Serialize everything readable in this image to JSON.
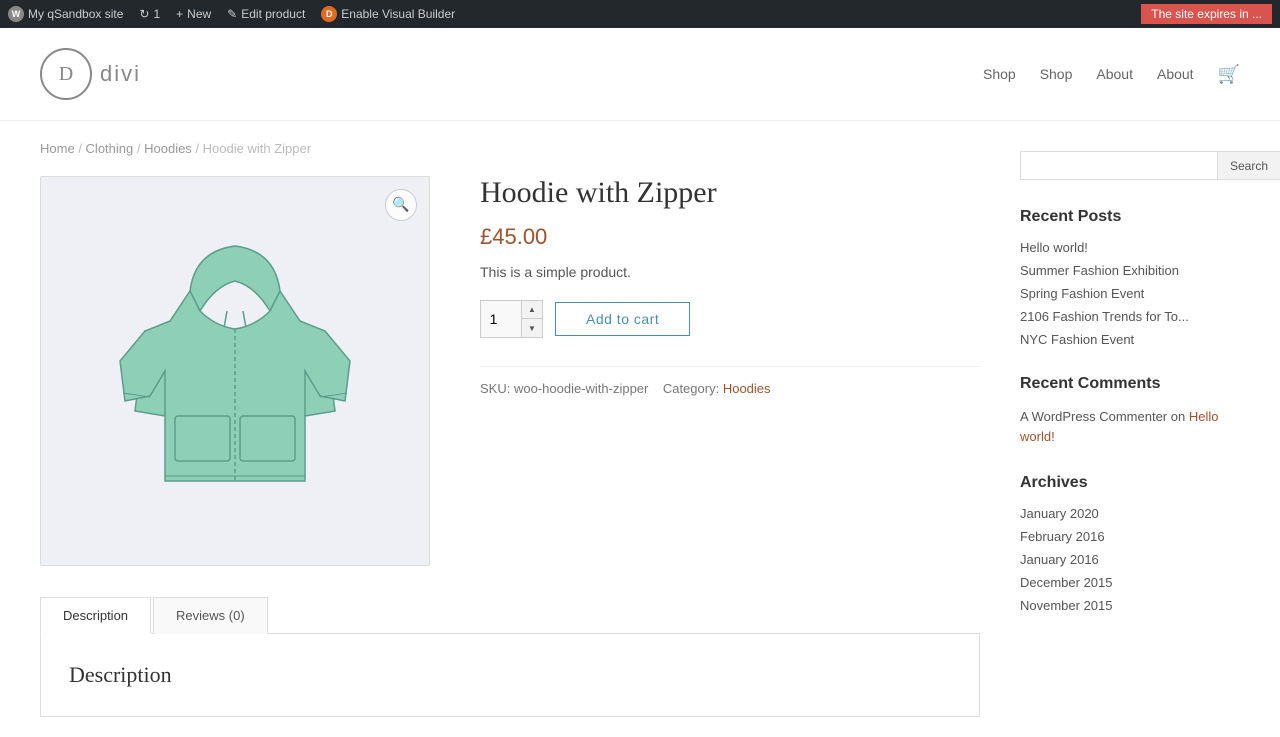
{
  "adminBar": {
    "site_name": "My qSandbox site",
    "update_count": "1",
    "new_label": "New",
    "edit_label": "Edit product",
    "enable_vb_label": "Enable Visual Builder",
    "expiry_label": "The site expires in ..."
  },
  "header": {
    "logo_letter": "D",
    "logo_text": "divi",
    "nav": [
      {
        "label": "Shop",
        "id": "shop1"
      },
      {
        "label": "Shop",
        "id": "shop2"
      },
      {
        "label": "About",
        "id": "about1"
      },
      {
        "label": "About",
        "id": "about2"
      }
    ],
    "cart_icon": "🛒"
  },
  "breadcrumb": {
    "items": [
      {
        "label": "Home",
        "href": "#"
      },
      {
        "label": "Clothing",
        "href": "#"
      },
      {
        "label": "Hoodies",
        "href": "#"
      },
      {
        "label": "Hoodie with Zipper",
        "href": "#",
        "current": true
      }
    ]
  },
  "product": {
    "title": "Hoodie with Zipper",
    "price": "£45.00",
    "description": "This is a simple product.",
    "qty_value": "1",
    "add_to_cart_label": "Add to cart",
    "sku_label": "SKU:",
    "sku_value": "woo-hoodie-with-zipper",
    "category_label": "Category:",
    "category_value": "Hoodies"
  },
  "tabs": [
    {
      "label": "Description",
      "active": true
    },
    {
      "label": "Reviews (0)",
      "active": false
    }
  ],
  "tab_content": {
    "description_title": "Description"
  },
  "sidebar": {
    "search_placeholder": "",
    "search_button_label": "Search",
    "recent_posts_title": "Recent Posts",
    "recent_posts": [
      {
        "label": "Hello world!"
      },
      {
        "label": "Summer Fashion Exhibition"
      },
      {
        "label": "Spring Fashion Event"
      },
      {
        "label": "2106 Fashion Trends for To..."
      },
      {
        "label": "NYC Fashion Event"
      }
    ],
    "recent_comments_title": "Recent Comments",
    "comment_text": "A WordPress Commenter on",
    "comment_link": "Hello world!",
    "archives_title": "Archives",
    "archives": [
      {
        "label": "January 2020"
      },
      {
        "label": "February 2016"
      },
      {
        "label": "January 2016"
      },
      {
        "label": "December 2015"
      },
      {
        "label": "November 2015"
      }
    ]
  }
}
